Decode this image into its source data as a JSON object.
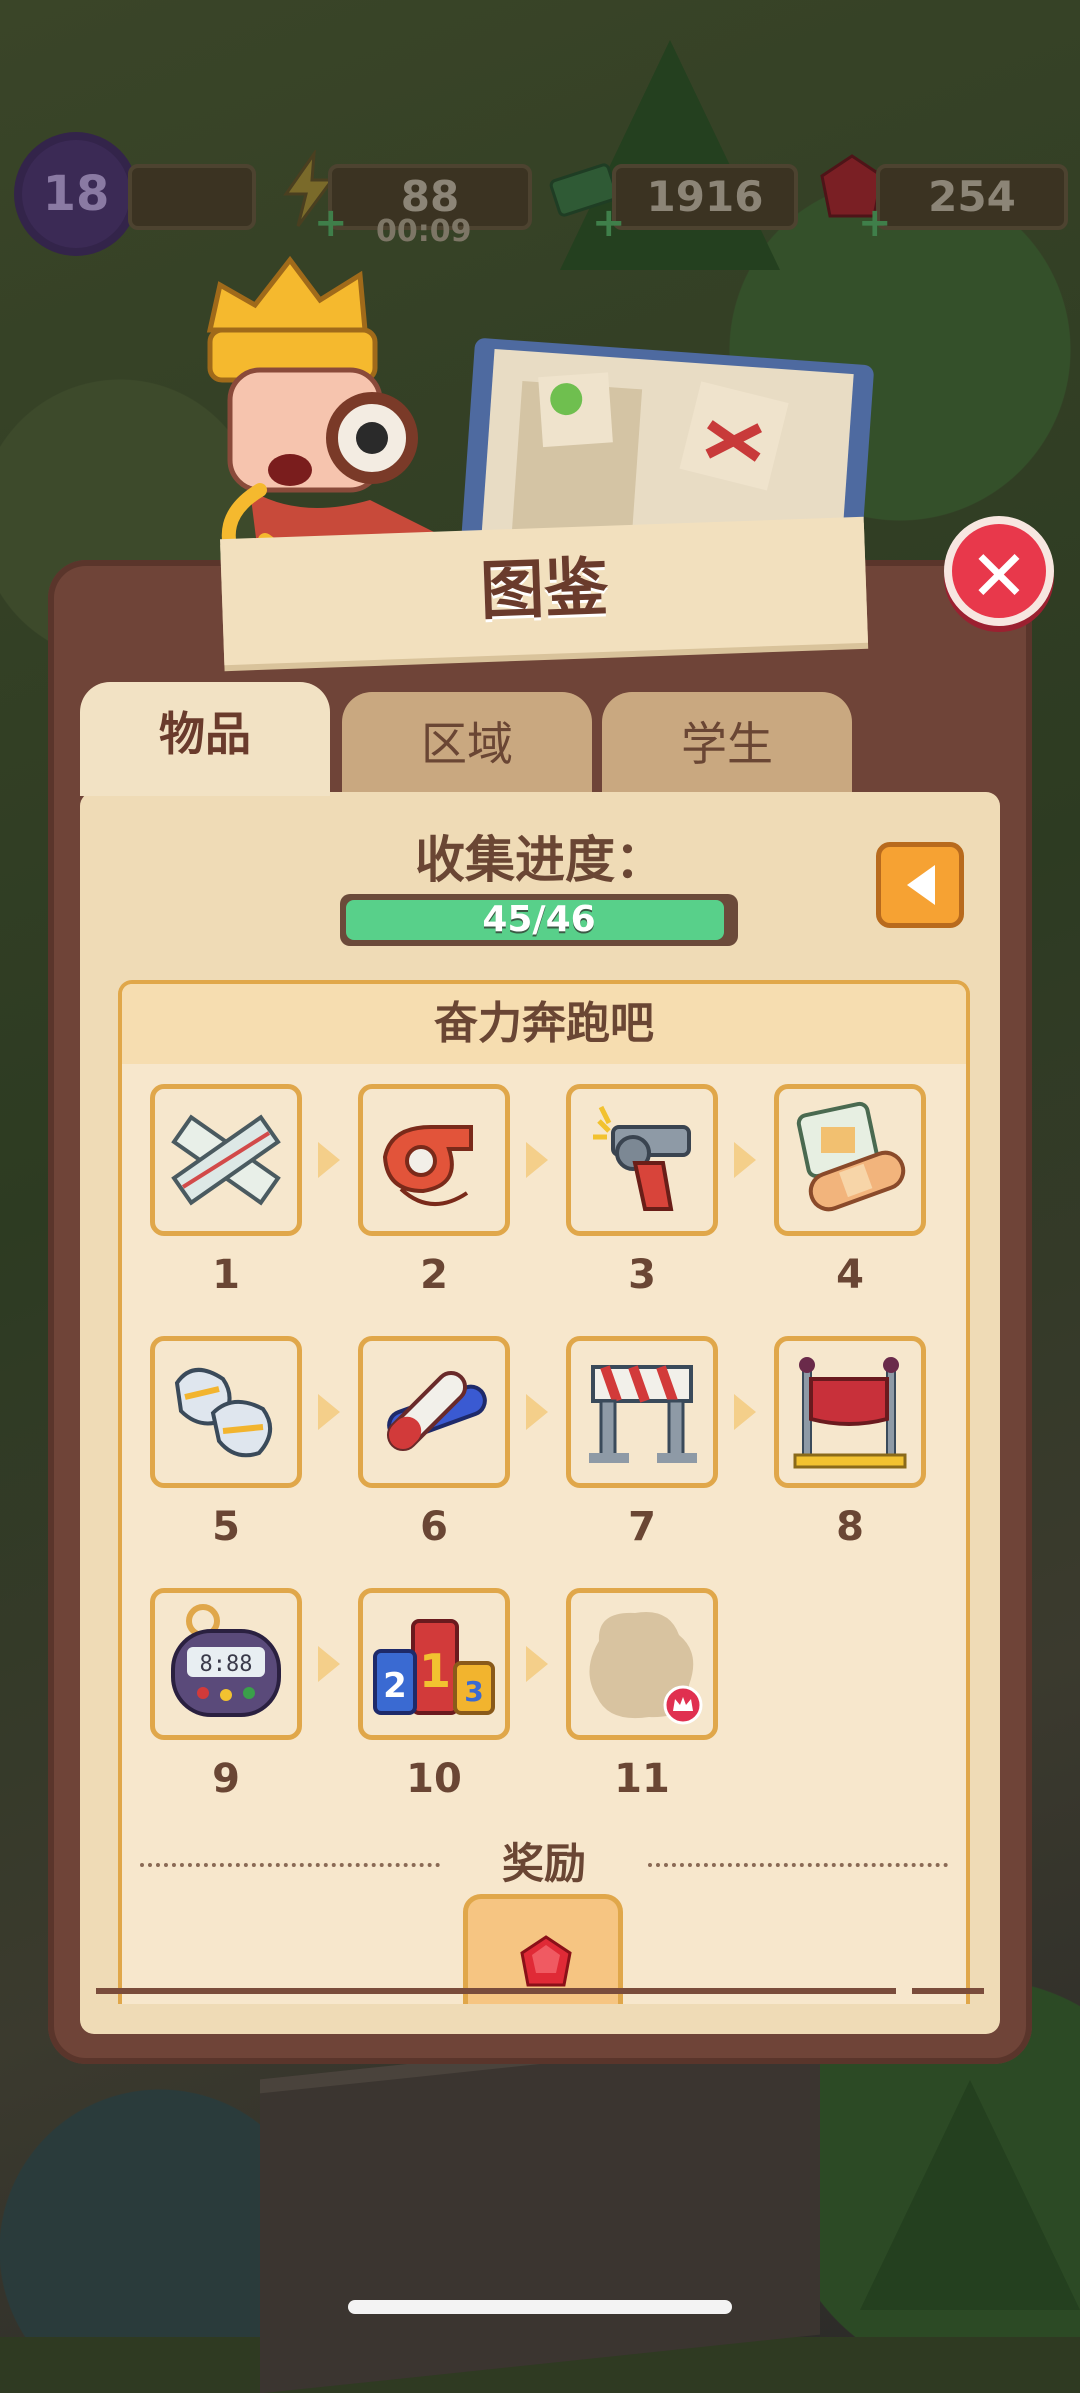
{
  "hud": {
    "level": "18",
    "energy": "88",
    "energy_timer": "00:09",
    "cash": "1916",
    "gems": "254"
  },
  "panel": {
    "title": "图鉴",
    "tabs": [
      {
        "label": "物品",
        "active": true
      },
      {
        "label": "区域",
        "active": false
      },
      {
        "label": "学生",
        "active": false
      }
    ],
    "progress": {
      "label": "收集进度：",
      "text": "45/46",
      "value": 45,
      "max": 46
    },
    "set": {
      "title": "奋力奔跑吧",
      "items": [
        {
          "number": "1",
          "icon": "race-tape-icon",
          "collected": true
        },
        {
          "number": "2",
          "icon": "whistle-icon",
          "collected": true
        },
        {
          "number": "3",
          "icon": "starting-pistol-icon",
          "collected": true
        },
        {
          "number": "4",
          "icon": "bandage-icon",
          "collected": true
        },
        {
          "number": "5",
          "icon": "sneakers-icon",
          "collected": true
        },
        {
          "number": "6",
          "icon": "relay-baton-icon",
          "collected": true
        },
        {
          "number": "7",
          "icon": "hurdle-icon",
          "collected": true
        },
        {
          "number": "8",
          "icon": "finish-line-icon",
          "collected": true
        },
        {
          "number": "9",
          "icon": "stopwatch-icon",
          "collected": true
        },
        {
          "number": "10",
          "icon": "podium-icon",
          "collected": true
        },
        {
          "number": "11",
          "icon": "unknown-item-icon",
          "collected": false
        }
      ],
      "reward_label": "奖励",
      "reward_icon": "red-gem-icon"
    }
  },
  "colors": {
    "panel_border": "#6f4438",
    "panel_fill": "#efdbb6",
    "progress_fill": "#58d08a",
    "close_button": "#e8384b",
    "back_button": "#f6a233"
  }
}
